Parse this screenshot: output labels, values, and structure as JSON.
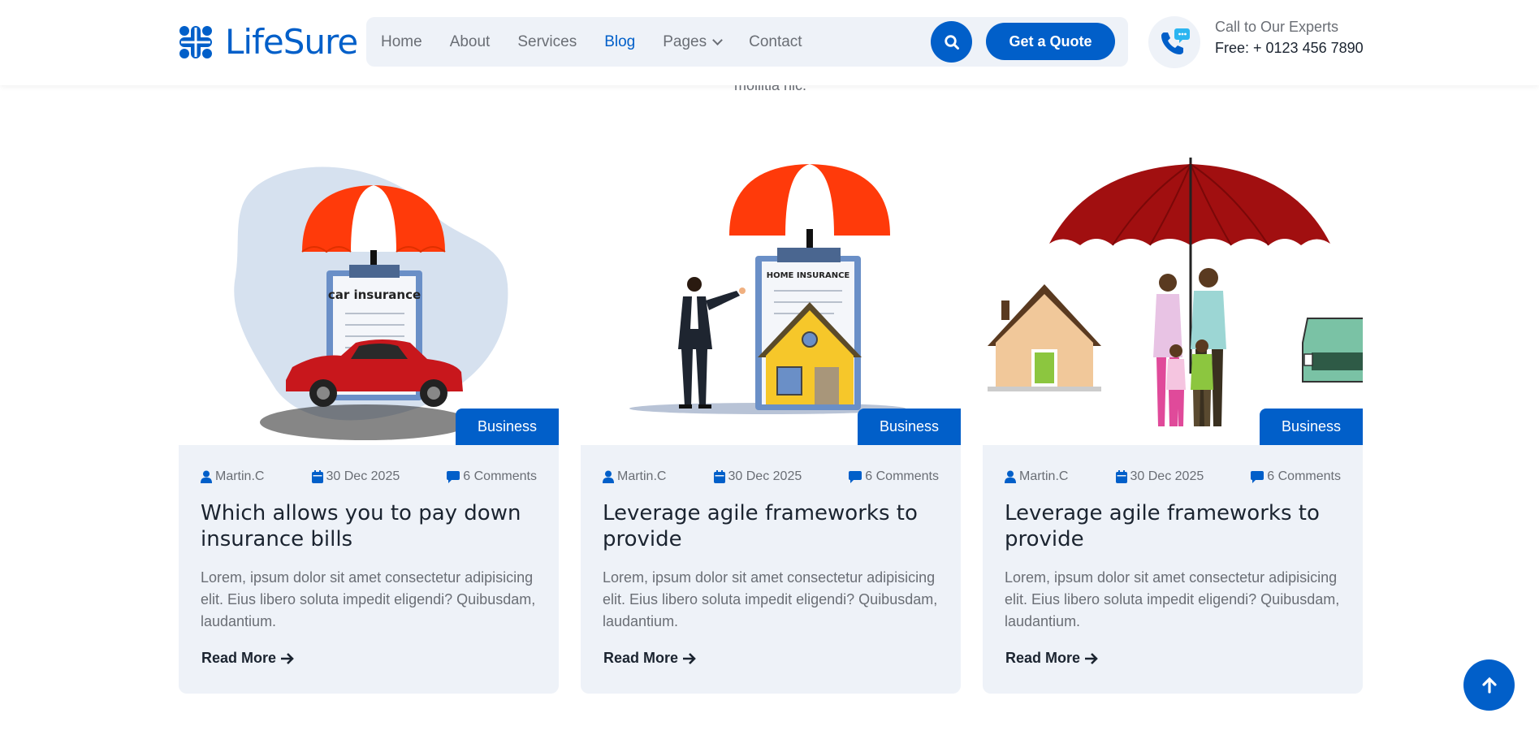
{
  "brand": {
    "name": "LifeSure",
    "color": "#015fc9"
  },
  "nav": {
    "items": [
      {
        "label": "Home"
      },
      {
        "label": "About"
      },
      {
        "label": "Services"
      },
      {
        "label": "Blog",
        "active": true
      },
      {
        "label": "Pages",
        "dropdown": true
      },
      {
        "label": "Contact"
      }
    ],
    "search_icon": "search-icon",
    "quote_button": "Get a Quote"
  },
  "contact": {
    "label": "Call to Our Experts",
    "number": "Free: + 0123 456 7890",
    "icon": "phone-chat-icon"
  },
  "intro_fragment": "mollitia nic.",
  "cards": [
    {
      "image": "car-insurance-illustration",
      "image_text": "car insurance",
      "badge": "Business",
      "author": "Martin.C",
      "date": "30 Dec 2025",
      "comments": "6 Comments",
      "title": "Which allows you to pay down insurance bills",
      "text": "Lorem, ipsum dolor sit amet consectetur adipisicing elit. Eius libero soluta impedit eligendi? Quibusdam, laudantium.",
      "link": "Read More"
    },
    {
      "image": "home-insurance-illustration",
      "image_text": "HOME INSURANCE",
      "badge": "Business",
      "author": "Martin.C",
      "date": "30 Dec 2025",
      "comments": "6 Comments",
      "title": "Leverage agile frameworks to provide",
      "text": "Lorem, ipsum dolor sit amet consectetur adipisicing elit. Eius libero soluta impedit eligendi? Quibusdam, laudantium.",
      "link": "Read More"
    },
    {
      "image": "family-insurance-illustration",
      "badge": "Business",
      "author": "Martin.C",
      "date": "30 Dec 2025",
      "comments": "6 Comments",
      "title": "Leverage agile frameworks to provide",
      "text": "Lorem, ipsum dolor sit amet consectetur adipisicing elit. Eius libero soluta impedit eligendi? Quibusdam, laudantium.",
      "link": "Read More"
    }
  ],
  "scroll_top_icon": "arrow-up-icon"
}
